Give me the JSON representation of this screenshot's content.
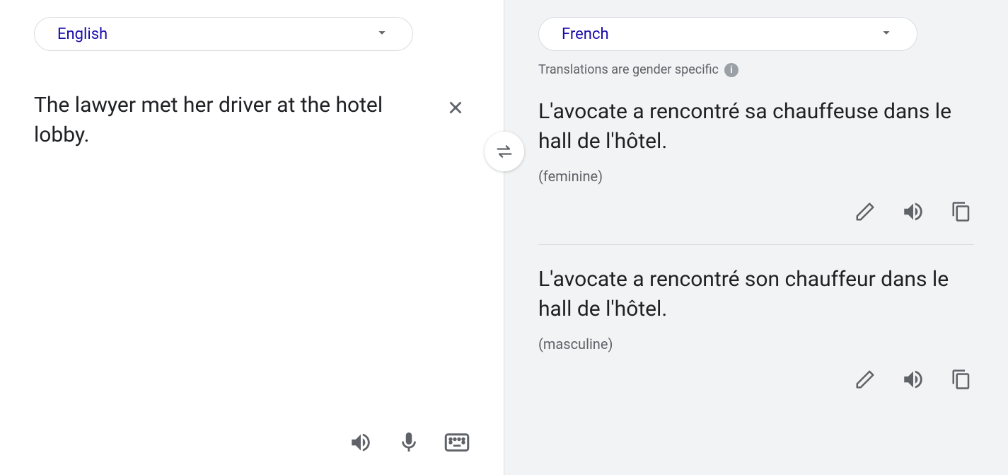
{
  "source": {
    "language": "English",
    "text": "The lawyer met her driver at the hotel lobby."
  },
  "target": {
    "language": "French",
    "notice": "Translations are gender specific",
    "translations": [
      {
        "text": "L'avocate a rencontré sa chauffeuse dans le hall de l'hôtel.",
        "gender_label": "(feminine)"
      },
      {
        "text": "L'avocate a rencontré son chauffeur dans le hall de l'hôtel.",
        "gender_label": "(masculine)"
      }
    ]
  }
}
